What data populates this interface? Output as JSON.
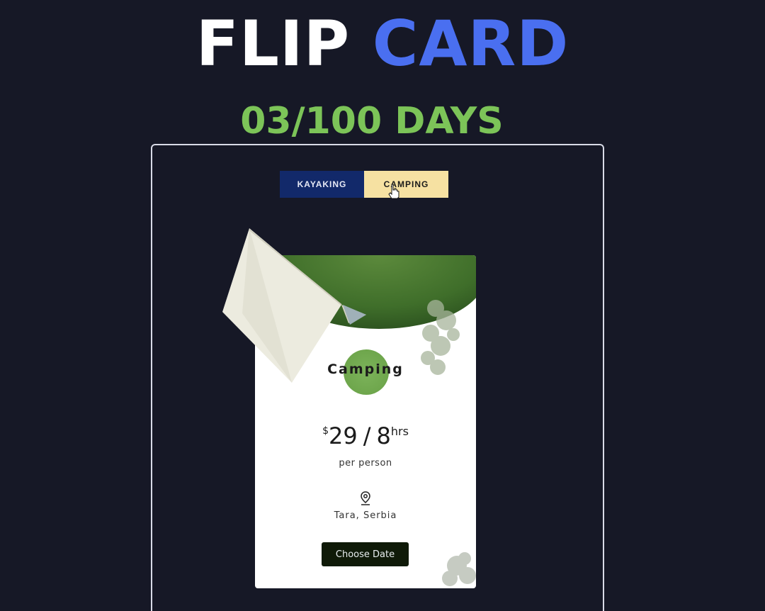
{
  "header": {
    "title_word1": "FLIP",
    "title_word2": "CARD",
    "progress": "03/100 DAYS"
  },
  "tabs": [
    {
      "label": "KAYAKING",
      "active": false
    },
    {
      "label": "CAMPING",
      "active": true
    }
  ],
  "card": {
    "title": "Camping",
    "price_symbol": "$",
    "price": "29",
    "duration": "8",
    "duration_unit": "hrs",
    "per": "per person",
    "location": "Tara, Serbia",
    "button_label": "Choose Date"
  },
  "colors": {
    "background": "#161826",
    "accent_blue": "#4a6ff0",
    "accent_green": "#7cc458",
    "tab_inactive": "#12296a",
    "tab_active": "#f6e1a2",
    "button": "#0f1a08"
  }
}
